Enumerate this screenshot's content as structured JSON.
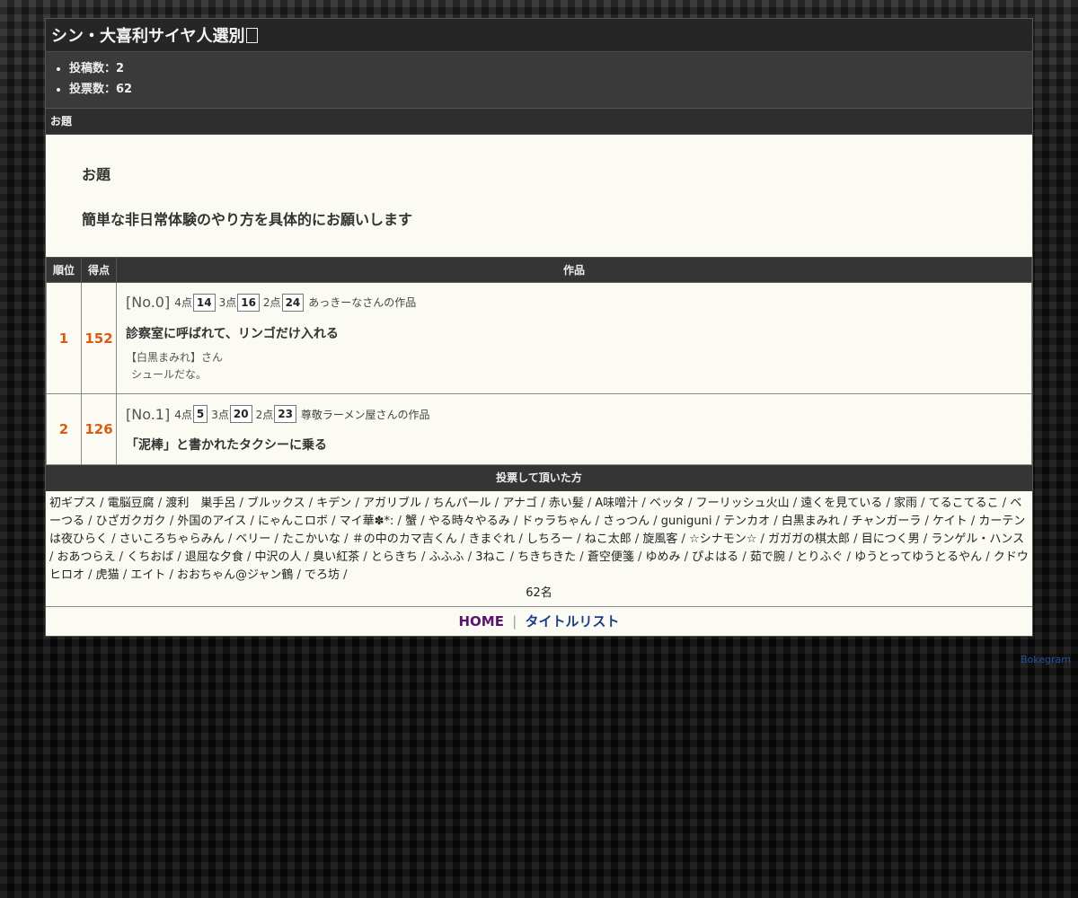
{
  "page": {
    "title": "シン・大喜利サイヤ人選別",
    "title_icon": "missing-glyph-box"
  },
  "stats": {
    "posts": "投稿数：2",
    "votes": "投票数：62"
  },
  "theme": {
    "header": "お題",
    "label": "お題",
    "text": "簡単な非日常体験のやり方を具体的にお願いします"
  },
  "table": {
    "headers": {
      "rank": "順位",
      "score": "得点",
      "work": "作品"
    },
    "entries": [
      {
        "rank": "1",
        "score": "152",
        "no": "[No.0]",
        "p4_label": "4点",
        "p4": "14",
        "p3_label": "3点",
        "p3": "16",
        "p2_label": "2点",
        "p2": "24",
        "author": "あっきーなさんの作品",
        "title": "診察室に呼ばれて、リンゴだけ入れる",
        "comment_by": "【白黒まみれ】さん",
        "comment": "シュールだな。"
      },
      {
        "rank": "2",
        "score": "126",
        "no": "[No.1]",
        "p4_label": "4点",
        "p4": "5",
        "p3_label": "3点",
        "p3": "20",
        "p2_label": "2点",
        "p2": "23",
        "author": "尊敬ラーメン屋さんの作品",
        "title": "「泥棒」と書かれたタクシーに乗る"
      }
    ]
  },
  "voters": {
    "header": "投票して頂いた方",
    "names": [
      "初ギプス",
      "電脳豆腐",
      "渡利　巣手呂",
      "ブルックス",
      "キデン",
      "アガリブル",
      "ちんパール",
      "アナゴ",
      "赤い髪",
      "A味噌汁",
      "ベッタ",
      "フーリッシュ火山",
      "遠くを見ている",
      "家雨",
      "てるこてるこ",
      "ベーつる",
      "ひざガクガク",
      "外国のアイス",
      "にゃんこロボ",
      "マイ華✽*:",
      "蟹",
      "やる時々やるみ",
      "ドゥラちゃん",
      "さっつん",
      "guniguni",
      "テンカオ",
      "白黒まみれ",
      "チャンガーラ",
      "ケイト",
      "カーテンは夜ひらく",
      "さいころちゃらみん",
      "ベリー",
      "たこかいな",
      "＃の中のカマ吉くん",
      "きまぐれ",
      "しちろー",
      "ねこ太郎",
      "旋風客",
      "☆シナモン☆",
      "ガガガの棋太郎",
      "目につく男",
      "ランゲル・ハンス",
      "おあつらえ",
      "くちおば",
      "退屈な夕食",
      "中沢の人",
      "臭い紅茶",
      "とらきち",
      "ふふふ",
      "3ねこ",
      "ちきちきた",
      "蒼空便箋",
      "ゆめみ",
      "ぴよはる",
      "茹で腕",
      "とりふぐ",
      "ゆうとってゆうとるやん",
      "クドウヒロオ",
      "虎猫",
      "エイト",
      "おおちゃん@ジャン鶴",
      "でろ坊"
    ],
    "separator": " / ",
    "count": "62名"
  },
  "footer": {
    "home": "HOME",
    "divider": "|",
    "title_list": "タイトルリスト"
  },
  "credit": "Bokegram",
  "colors": {
    "accent_score": "#dd5a12",
    "home_link": "#5a1470",
    "title_list_link": "#1a3f8a",
    "panel_bg": "#fbfbf4",
    "header_bg": "#353535"
  }
}
